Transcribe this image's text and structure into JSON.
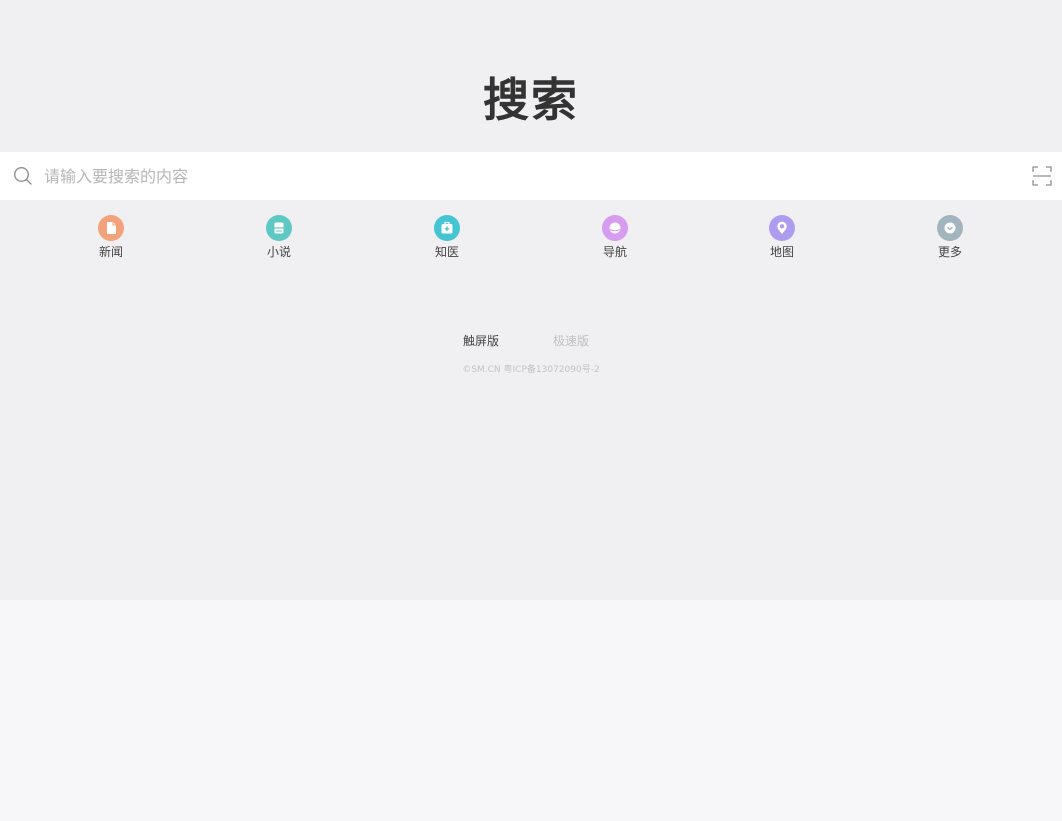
{
  "logo": {
    "text": "搜索"
  },
  "search": {
    "placeholder": "请输入要搜索的内容"
  },
  "nav": {
    "items": [
      {
        "label": "新闻",
        "icon": "news-icon",
        "color": "#f4a27c"
      },
      {
        "label": "小说",
        "icon": "book-icon",
        "color": "#5ec9c4"
      },
      {
        "label": "知医",
        "icon": "medical-kit-icon",
        "color": "#45c4d3"
      },
      {
        "label": "导航",
        "icon": "compass-icon",
        "color": "#d59cf0"
      },
      {
        "label": "地图",
        "icon": "map-pin-icon",
        "color": "#ae9cf0"
      },
      {
        "label": "更多",
        "icon": "more-icon",
        "color": "#a2b4bd"
      }
    ]
  },
  "footer": {
    "touch_version": "触屏版",
    "lite_version": "极速版",
    "copyright": "©SM.CN 粤ICP备13072090号-2"
  },
  "colors": {
    "background_top": "#f0f0f3",
    "background_bottom": "#f7f7f9",
    "logo": "#333333",
    "active_link": "#444444",
    "inactive_link": "#c0c0c3"
  }
}
